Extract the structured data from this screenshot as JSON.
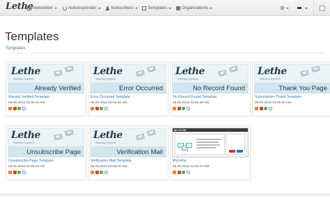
{
  "navbar": {
    "brand": "Lethe",
    "items": [
      {
        "label": "Newsletter",
        "icon": "envelope-icon"
      },
      {
        "label": "Autoresponder",
        "icon": "refresh-icon"
      },
      {
        "label": "Subscribers",
        "icon": "user-icon"
      },
      {
        "label": "Templates",
        "icon": "picture-icon"
      },
      {
        "label": "Organizations",
        "icon": "folder-icon"
      }
    ],
    "settings_icon": "gear-icon",
    "language_icon": "uk-flag-icon"
  },
  "page": {
    "title": "Templates",
    "breadcrumb": "Templates"
  },
  "templates": [
    {
      "name": "Already Verified Template",
      "date": "06.05.2015 03:05:40 AM",
      "thumb_logo": "Lethe",
      "thumb_tagline": "Mailing System",
      "thumb_caption": "Already Verified"
    },
    {
      "name": "Error Occurred Template",
      "date": "06.05.2015 03:05:40 AM",
      "thumb_logo": "Lethe",
      "thumb_tagline": "Mailing System",
      "thumb_caption": "Error Occurred"
    },
    {
      "name": "No Record Found Template",
      "date": "06.05.2015 03:05:40 AM",
      "thumb_logo": "Lethe",
      "thumb_tagline": "Mailing System",
      "thumb_caption": "No Record Found"
    },
    {
      "name": "Subscription Thank Template",
      "date": "06.05.2015 03:05:40 AM",
      "thumb_logo": "Lethe",
      "thumb_tagline": "Mailing System",
      "thumb_caption": "Thank You Page"
    },
    {
      "name": "Unsubscribe Page Template",
      "date": "06.05.2015 03:05:40 AM",
      "thumb_logo": "Lethe",
      "thumb_tagline": "Mailing System",
      "thumb_caption": "Unsubscribe Page"
    },
    {
      "name": "Verification Mail Template",
      "date": "06.05.2015 03:05:40 AM",
      "thumb_logo": "Lethe",
      "thumb_tagline": "Mailing System",
      "thumb_caption": "Verification Mail"
    },
    {
      "name": "MyLethe",
      "date": "06.05.2015 12:01:27 PM",
      "thumb_brand": "MY LETHE"
    }
  ],
  "action_icons": [
    "edit-icon",
    "delete-icon",
    "preview-icon",
    "link-icon"
  ],
  "colors": {
    "link": "#2a7ab7",
    "navbar_bg": "#efefef",
    "thumb_bg": "#eaf3f6"
  }
}
